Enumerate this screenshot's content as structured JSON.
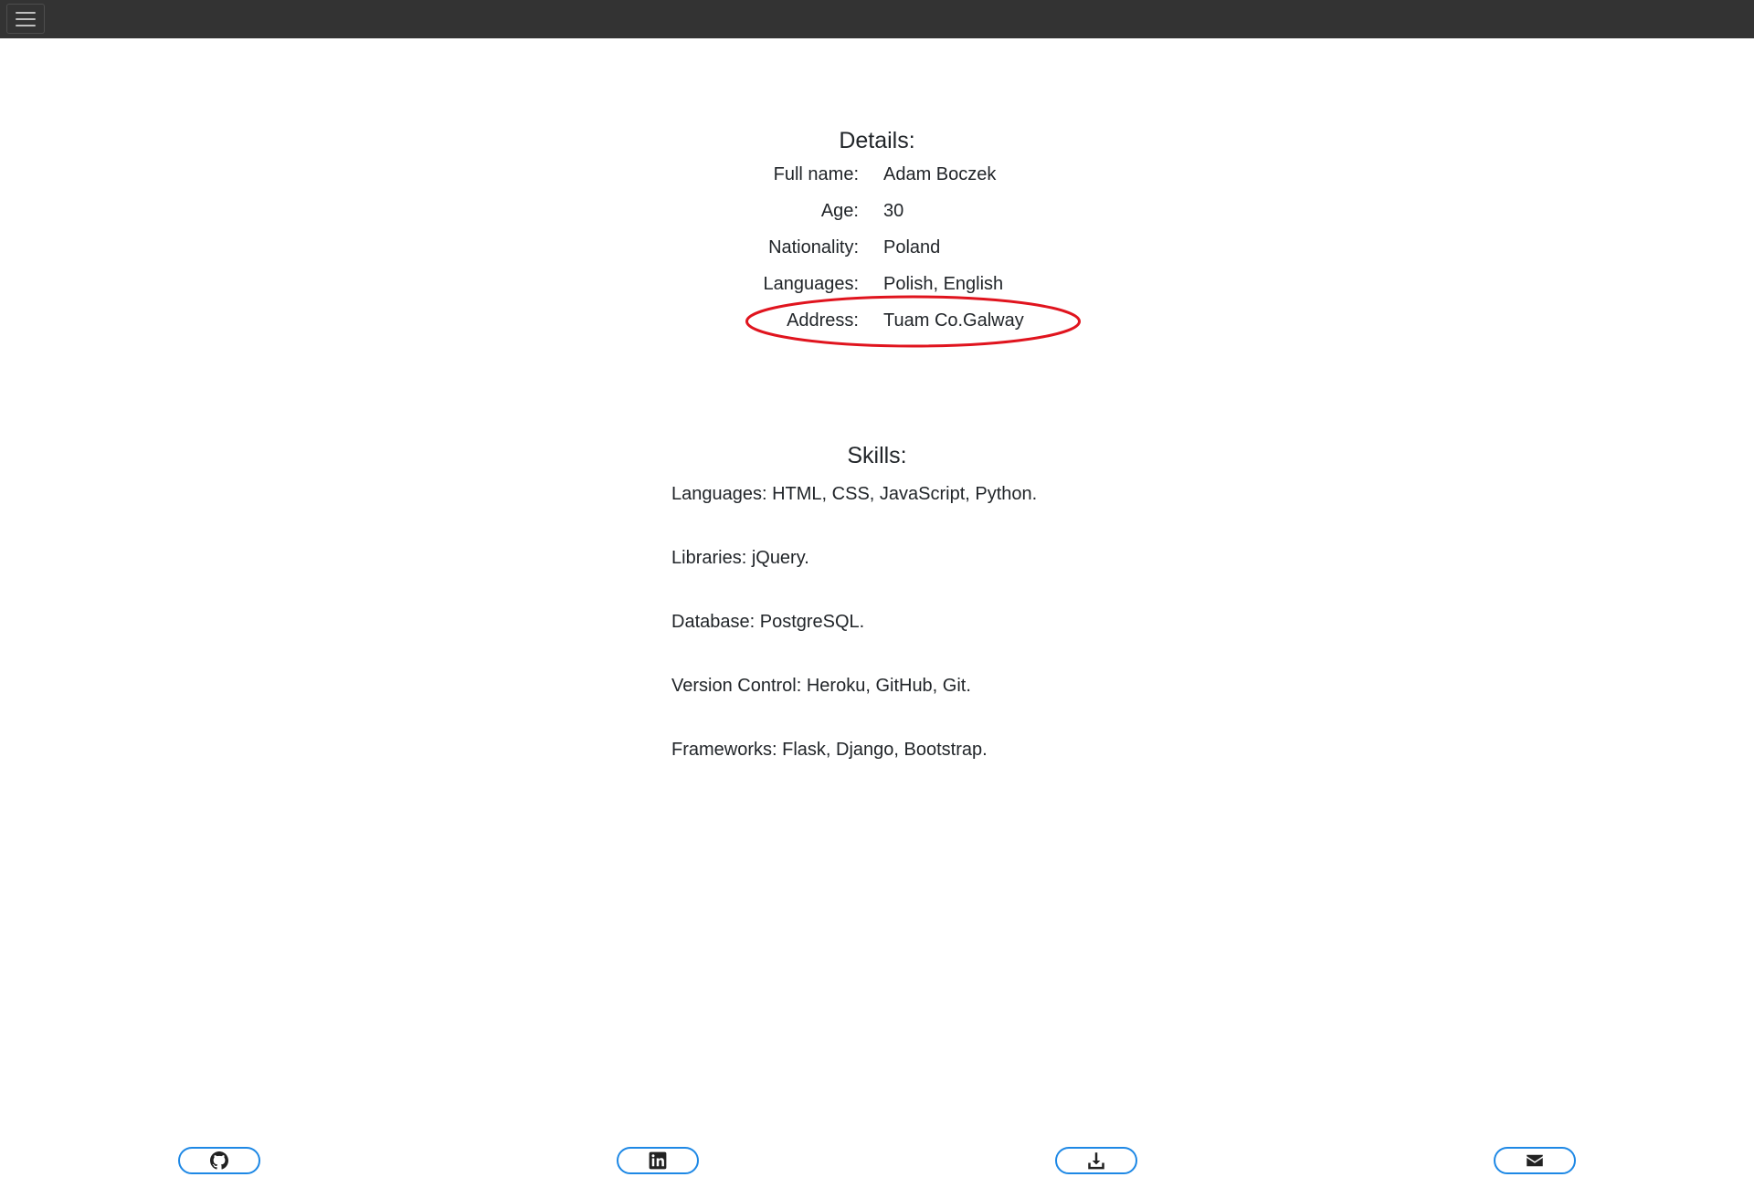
{
  "navbar": {
    "toggle_icon": "hamburger-menu-icon"
  },
  "details": {
    "title": "Details:",
    "rows": [
      {
        "label": "Full name:",
        "value": "Adam Boczek"
      },
      {
        "label": "Age:",
        "value": "30"
      },
      {
        "label": "Nationality:",
        "value": "Poland"
      },
      {
        "label": "Languages:",
        "value": "Polish, English"
      },
      {
        "label": "Address:",
        "value": "Tuam Co.Galway"
      }
    ],
    "highlight_color": "#e0141e"
  },
  "skills": {
    "title": "Skills:",
    "items": [
      "Languages: HTML, CSS, JavaScript, Python.",
      "Libraries: jQuery.",
      "Database: PostgreSQL.",
      "Version Control: Heroku, GitHub, Git.",
      "Frameworks: Flask, Django, Bootstrap."
    ]
  },
  "footer": {
    "accent": "#1e88e5",
    "buttons": [
      {
        "icon": "github-icon"
      },
      {
        "icon": "linkedin-icon"
      },
      {
        "icon": "download-icon"
      },
      {
        "icon": "envelope-icon"
      }
    ]
  }
}
